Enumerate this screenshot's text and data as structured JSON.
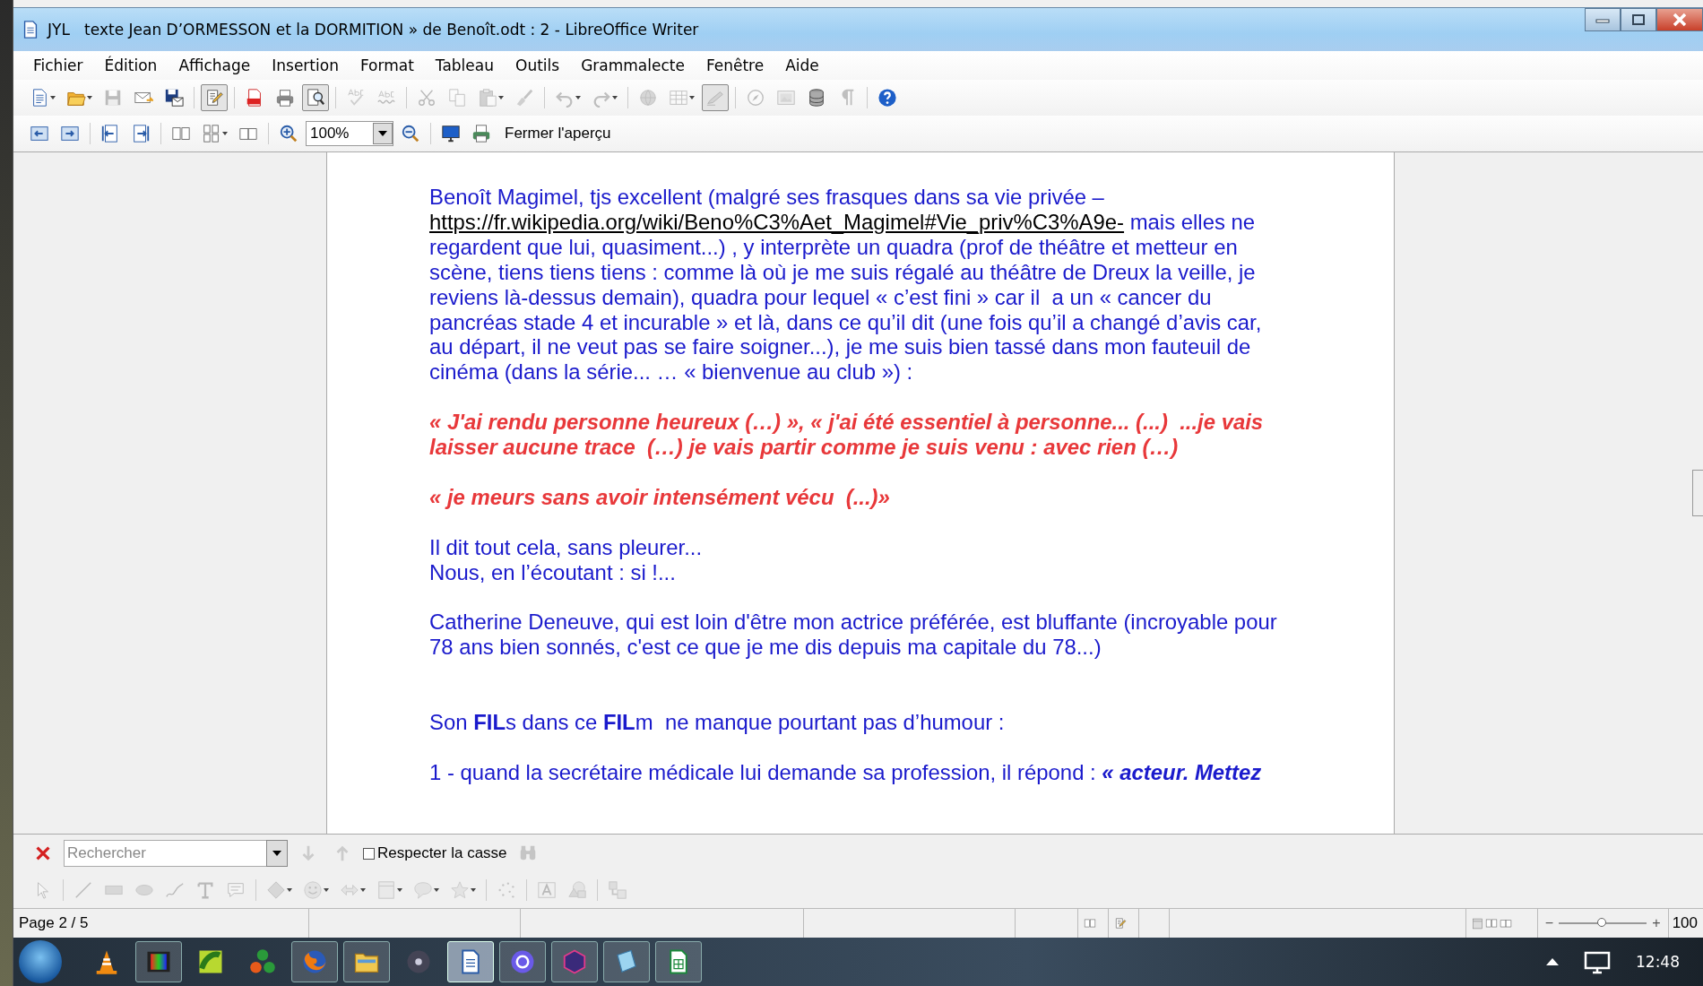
{
  "window": {
    "title": "JYL   texte Jean D’ORMESSON et la DORMITION » de Benoît.odt : 2 - LibreOffice Writer"
  },
  "menu": [
    "Fichier",
    "Édition",
    "Affichage",
    "Insertion",
    "Format",
    "Tableau",
    "Outils",
    "Grammalecte",
    "Fenêtre",
    "Aide"
  ],
  "toolbar": {
    "buttons": [
      {
        "disabled": false,
        "pressed": false,
        "dropdown": true
      },
      {
        "disabled": false,
        "pressed": false,
        "dropdown": true
      },
      {
        "disabled": true,
        "pressed": false,
        "dropdown": false
      },
      {
        "disabled": false,
        "pressed": false,
        "dropdown": false
      },
      {
        "disabled": false,
        "pressed": false,
        "dropdown": false
      },
      {
        "disabled": false,
        "pressed": true,
        "dropdown": false
      },
      {
        "disabled": false,
        "pressed": false,
        "dropdown": false
      },
      {
        "disabled": false,
        "pressed": false,
        "dropdown": false
      },
      {
        "disabled": false,
        "pressed": true,
        "dropdown": false
      },
      {
        "disabled": true,
        "pressed": false,
        "dropdown": false
      },
      {
        "disabled": true,
        "pressed": false,
        "dropdown": false
      },
      {
        "disabled": true,
        "pressed": false,
        "dropdown": false
      },
      {
        "disabled": true,
        "pressed": false,
        "dropdown": false
      },
      {
        "disabled": true,
        "pressed": false,
        "dropdown": true
      },
      {
        "disabled": true,
        "pressed": false,
        "dropdown": false
      },
      {
        "disabled": true,
        "pressed": false,
        "dropdown": true
      },
      {
        "disabled": true,
        "pressed": false,
        "dropdown": true
      },
      {
        "disabled": true,
        "pressed": false,
        "dropdown": false
      },
      {
        "disabled": true,
        "pressed": false,
        "dropdown": true
      },
      {
        "disabled": true,
        "pressed": true,
        "dropdown": false
      },
      {
        "disabled": true,
        "pressed": false,
        "dropdown": false
      },
      {
        "disabled": true,
        "pressed": false,
        "dropdown": false
      },
      {
        "disabled": false,
        "pressed": false,
        "dropdown": false
      },
      {
        "disabled": true,
        "pressed": false,
        "dropdown": false
      },
      {
        "disabled": false,
        "pressed": false,
        "dropdown": false
      }
    ]
  },
  "preview_toolbar": {
    "buttons": [
      {
        "disabled": false,
        "dropdown": false
      },
      {
        "disabled": false,
        "dropdown": false
      },
      {
        "disabled": false,
        "dropdown": false
      },
      {
        "disabled": false,
        "dropdown": false
      },
      {
        "disabled": false,
        "dropdown": false
      },
      {
        "disabled": false,
        "dropdown": true
      },
      {
        "disabled": false,
        "dropdown": false
      },
      {
        "disabled": false,
        "dropdown": false
      },
      {
        "disabled": false,
        "dropdown": false
      },
      {
        "disabled": false,
        "dropdown": false
      },
      {
        "disabled": false,
        "dropdown": false
      }
    ],
    "zoom_value": "100%",
    "close_label": "Fermer l'aperçu"
  },
  "document": {
    "paragraphs": [
      {
        "kind": "text",
        "lines": [
          {
            "text": "Benoît Magimel, tjs excellent (malgré ses frasques dans sa vie privée –"
          },
          {
            "link": "https://fr.wikipedia.org/wiki/Beno%C3%Aet_Magimel#Vie_priv%C3%A9e-",
            "text": " mais elles ne"
          },
          {
            "text": "regardent que lui, quasiment...) , y interprète un quadra (prof de théâtre et metteur en"
          },
          {
            "text": "scène, tiens tiens tiens : comme là où je me suis régalé au théâtre de Dreux la veille, je"
          },
          {
            "text": "reviens là-dessus demain), quadra pour lequel « c’est fini » car il  a un « cancer du"
          },
          {
            "text": "pancréas stade 4 et incurable » et là, dans ce qu’il dit (une fois qu’il a changé d’avis car,"
          },
          {
            "text": "au départ, il ne veut pas se faire soigner...), je me suis bien tassé dans mon fauteuil de"
          },
          {
            "text": "cinéma (dans la série... … « bienvenue au club ») :"
          }
        ]
      },
      {
        "kind": "quote",
        "lines": [
          {
            "text": "« J'ai rendu personne heureux (…) », « j'ai été essentiel à personne... (...)  ...je vais"
          },
          {
            "text": "laisser aucune trace  (…) je vais partir comme je suis venu : avec rien (…)"
          }
        ]
      },
      {
        "kind": "quote",
        "lines": [
          {
            "text": "« je meurs sans avoir intensément vécu  (...)»"
          }
        ]
      },
      {
        "kind": "text",
        "lines": [
          {
            "text": "Il dit tout cela, sans pleurer..."
          },
          {
            "text": "Nous, en l’écoutant : si !..."
          }
        ]
      },
      {
        "kind": "text",
        "lines": [
          {
            "text": "Catherine Deneuve, qui est loin d'être mon actrice préférée, est bluffante (incroyable pour"
          },
          {
            "text": "78 ans bien sonnés, c'est ce que je me dis depuis ma capitale du 78...)"
          }
        ]
      },
      {
        "kind": "text",
        "lines": [
          {
            "text": "Son **FIL**s dans ce **FIL**m  ne manque pourtant pas d’humour :"
          }
        ]
      },
      {
        "kind": "text",
        "lines": [
          {
            "text": "1 - quand la secrétaire médicale lui demande sa profession, il répond : ",
            "emphasis": "« acteur. Mettez"
          }
        ]
      }
    ]
  },
  "find_bar": {
    "placeholder": "Rechercher",
    "down": {
      "disabled": true
    },
    "up": {
      "disabled": true
    },
    "match_case": {
      "label": "Respecter la casse",
      "checked": false
    },
    "find": {
      "disabled": true
    }
  },
  "drawing_toolbar": {
    "buttons": [
      {
        "disabled": true,
        "dropdown": false
      },
      {
        "disabled": true,
        "dropdown": false
      },
      {
        "disabled": true,
        "dropdown": false
      },
      {
        "disabled": true,
        "dropdown": false
      },
      {
        "disabled": true,
        "dropdown": false
      },
      {
        "disabled": true,
        "dropdown": false
      },
      {
        "disabled": true,
        "dropdown": false
      },
      {
        "disabled": true,
        "dropdown": true
      },
      {
        "disabled": true,
        "dropdown": true
      },
      {
        "disabled": true,
        "dropdown": true
      },
      {
        "disabled": true,
        "dropdown": true
      },
      {
        "disabled": true,
        "dropdown": true
      },
      {
        "disabled": true,
        "dropdown": true
      },
      {
        "disabled": true,
        "dropdown": false
      },
      {
        "disabled": true,
        "dropdown": false
      },
      {
        "disabled": true,
        "dropdown": false
      },
      {
        "disabled": true,
        "dropdown": false
      }
    ]
  },
  "status_bar": {
    "page": "Page 2 / 5",
    "zoom_minus": "−",
    "zoom_plus": "+",
    "zoom_slider": {
      "level": 0.5
    },
    "zoom_percent": "100"
  },
  "taskbar": {
    "apps": [
      {
        "running": false,
        "active": false
      },
      {
        "running": true,
        "active": false
      },
      {
        "running": false,
        "active": false
      },
      {
        "running": false,
        "active": false
      },
      {
        "running": true,
        "active": false
      },
      {
        "running": true,
        "active": false
      },
      {
        "running": false,
        "active": false
      },
      {
        "running": true,
        "active": true
      },
      {
        "running": true,
        "active": false
      },
      {
        "running": true,
        "active": false
      },
      {
        "running": true,
        "active": false
      },
      {
        "running": true,
        "active": false
      }
    ],
    "clock": "12:48"
  }
}
